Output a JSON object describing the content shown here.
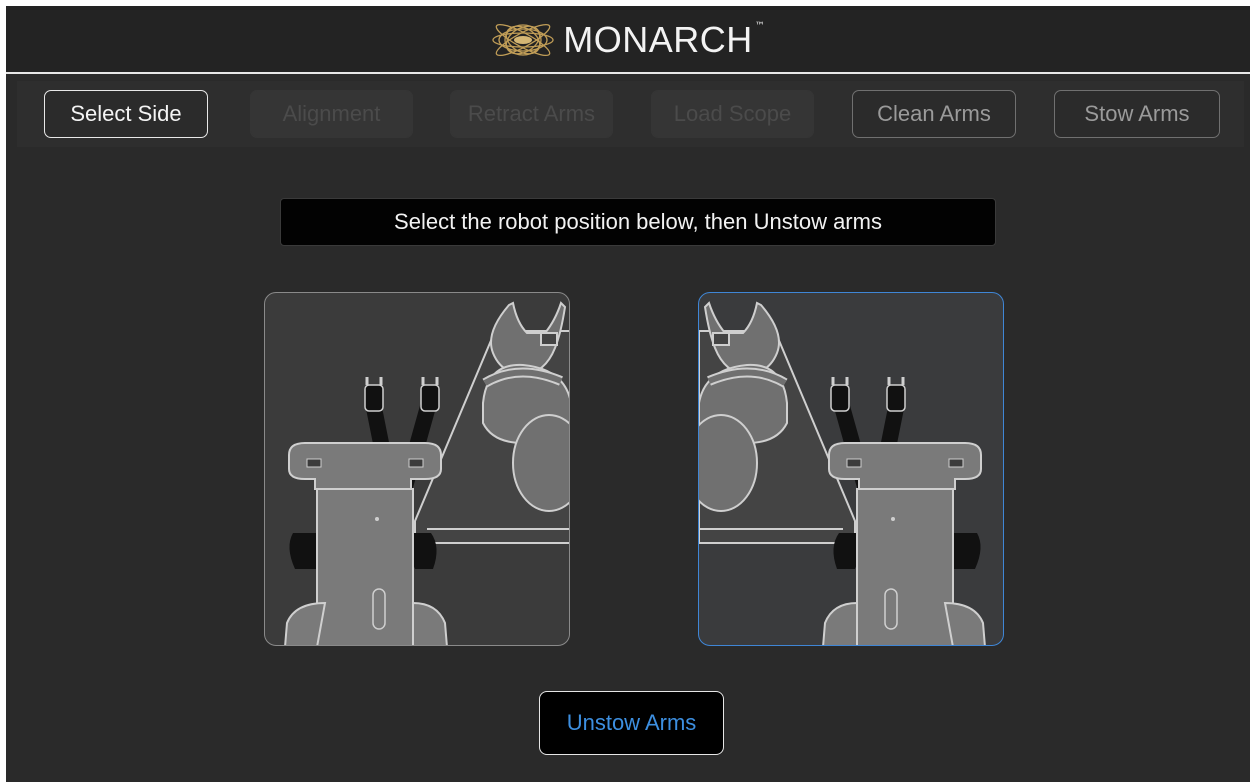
{
  "header": {
    "logo_icon": "monarch-logo-icon",
    "title": "MONARCH",
    "trademark": "™"
  },
  "tabs": [
    {
      "label": "Select Side",
      "state": "active"
    },
    {
      "label": "Alignment",
      "state": "disabled"
    },
    {
      "label": "Retract Arms",
      "state": "disabled"
    },
    {
      "label": "Load Scope",
      "state": "disabled"
    },
    {
      "label": "Clean Arms",
      "state": "enabled"
    },
    {
      "label": "Stow Arms",
      "state": "enabled"
    }
  ],
  "instruction": "Select the robot position below, then Unstow arms",
  "positions": [
    {
      "id": "patient-right-side",
      "selected": false,
      "icon": "robot-position-left-icon"
    },
    {
      "id": "patient-left-side",
      "selected": true,
      "icon": "robot-position-right-icon"
    }
  ],
  "primary_button": "Unstow Arms",
  "colors": {
    "accent": "#3d8fe0",
    "selected_border": "#3f86d6",
    "background": "#2a2a2a",
    "logo_gold": "#c9a45a"
  }
}
